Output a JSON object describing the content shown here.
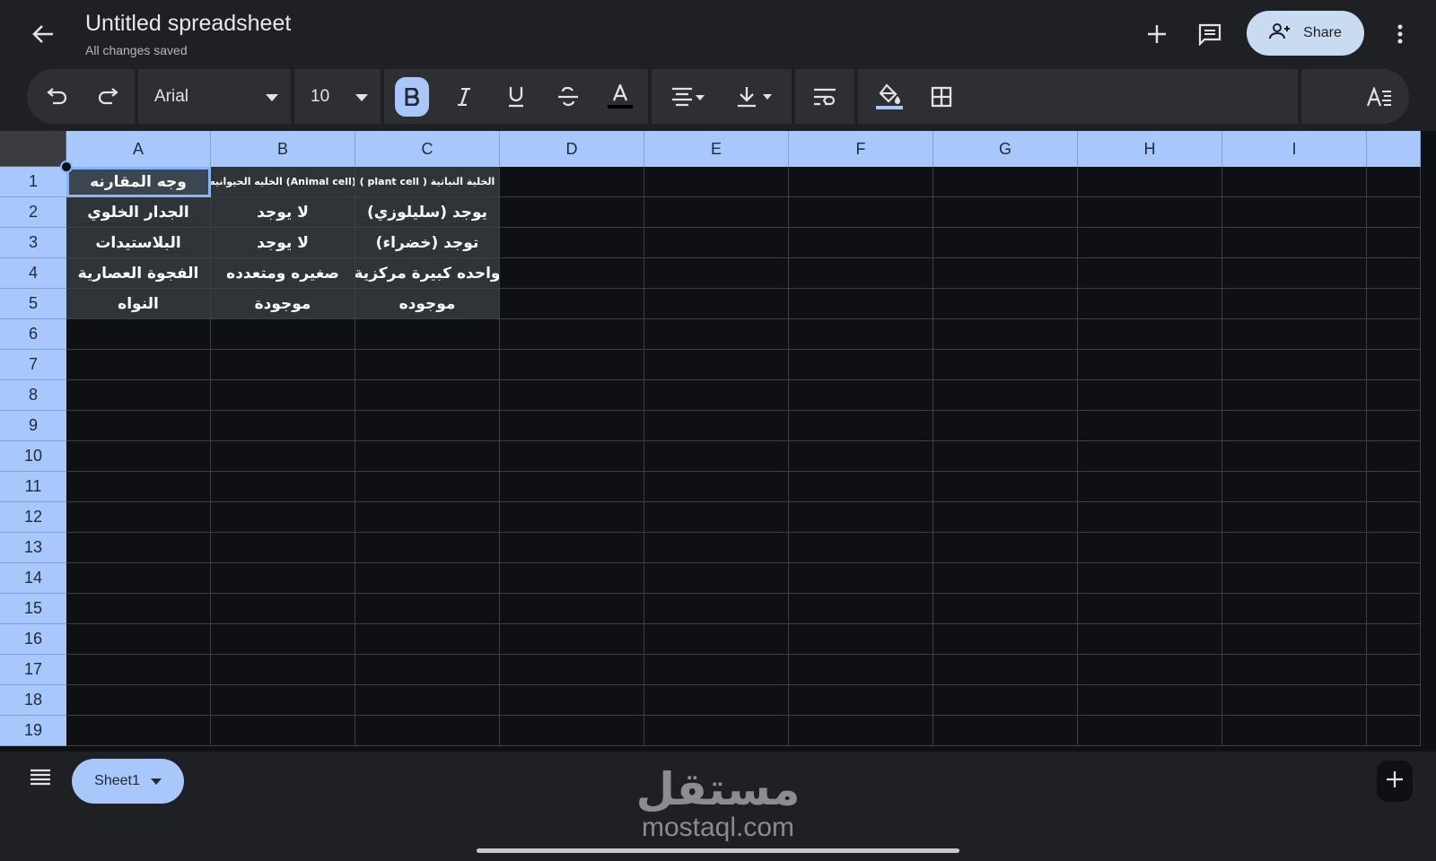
{
  "header": {
    "title": "Untitled spreadsheet",
    "status": "All changes saved",
    "share_label": "Share"
  },
  "toolbar": {
    "font": "Arial",
    "font_size": "10",
    "bold_active": true
  },
  "columns": [
    "A",
    "B",
    "C",
    "D",
    "E",
    "F",
    "G",
    "H",
    "I"
  ],
  "rows": [
    "1",
    "2",
    "3",
    "4",
    "5",
    "6",
    "7",
    "8",
    "9",
    "10",
    "11",
    "12",
    "13",
    "14",
    "15",
    "16",
    "17",
    "18",
    "19"
  ],
  "cells": [
    [
      "وجه المقارنه",
      "(Animal cell) الخليه الحيوانيه",
      "الخلية النباتية ( plant cell )"
    ],
    [
      "الجدار الخلوي",
      "لا يوجد",
      "يوجد (سليلوزي)"
    ],
    [
      "البلاستيدات",
      "لا يوجد",
      "توجد (خضراء)"
    ],
    [
      "الفجوة العصارية",
      "صغيره ومتعدده",
      "واحده كبيرة مركزية"
    ],
    [
      "النواه",
      "موجودة",
      "موجوده"
    ]
  ],
  "sheet_tab": "Sheet1",
  "watermark": {
    "arabic": "مستقل",
    "latin": "mostaql.com"
  },
  "colors": {
    "accent": "#a8c7fa",
    "background": "#1f2023",
    "grid": "#0e1013"
  }
}
